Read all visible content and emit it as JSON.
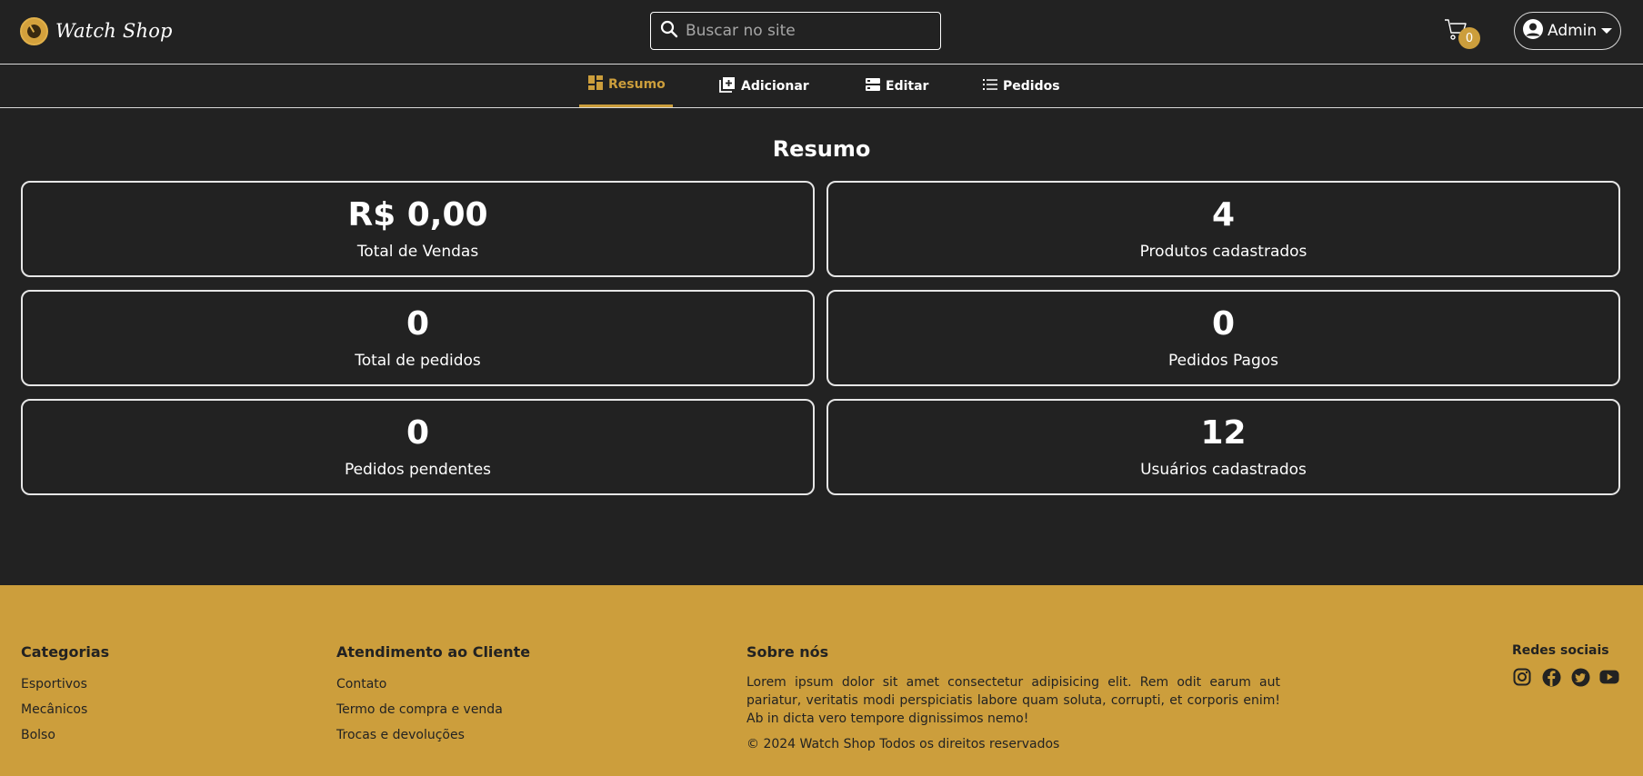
{
  "header": {
    "logo_text": "Watch Shop",
    "search_placeholder": "Buscar no site",
    "cart_count": "0",
    "user_label": "Admin"
  },
  "nav": {
    "tabs": [
      {
        "label": "Resumo",
        "icon": "dashboard-icon",
        "active": true
      },
      {
        "label": "Adicionar",
        "icon": "add-library-icon",
        "active": false
      },
      {
        "label": "Editar",
        "icon": "edit-panel-icon",
        "active": false
      },
      {
        "label": "Pedidos",
        "icon": "list-icon",
        "active": false
      }
    ]
  },
  "main": {
    "title": "Resumo",
    "cards": [
      {
        "value": "R$ 0,00",
        "label": "Total de Vendas"
      },
      {
        "value": "4",
        "label": "Produtos cadastrados"
      },
      {
        "value": "0",
        "label": "Total de pedidos"
      },
      {
        "value": "0",
        "label": "Pedidos Pagos"
      },
      {
        "value": "0",
        "label": "Pedidos pendentes"
      },
      {
        "value": "12",
        "label": "Usuários cadastrados"
      }
    ]
  },
  "footer": {
    "categories": {
      "title": "Categorias",
      "items": [
        "Esportivos",
        "Mecânicos",
        "Bolso"
      ]
    },
    "support": {
      "title": "Atendimento ao Cliente",
      "items": [
        "Contato",
        "Termo de compra e venda",
        "Trocas e devoluções"
      ]
    },
    "about": {
      "title": "Sobre nós",
      "text": "Lorem ipsum dolor sit amet consectetur adipisicing elit. Rem odit earum aut pariatur, veritatis modi perspiciatis labore quam soluta, corrupti, et corporis enim! Ab in dicta vero tempore dignissimos nemo!",
      "copyright": "© 2024 Watch Shop Todos os direitos reservados"
    },
    "social": {
      "title": "Redes sociais",
      "icons": [
        "instagram-icon",
        "facebook-icon",
        "twitter-icon",
        "youtube-icon"
      ]
    }
  },
  "colors": {
    "background": "#222222",
    "accent": "#cc9e3c",
    "text": "#ffffff",
    "footer_text": "#222222"
  }
}
